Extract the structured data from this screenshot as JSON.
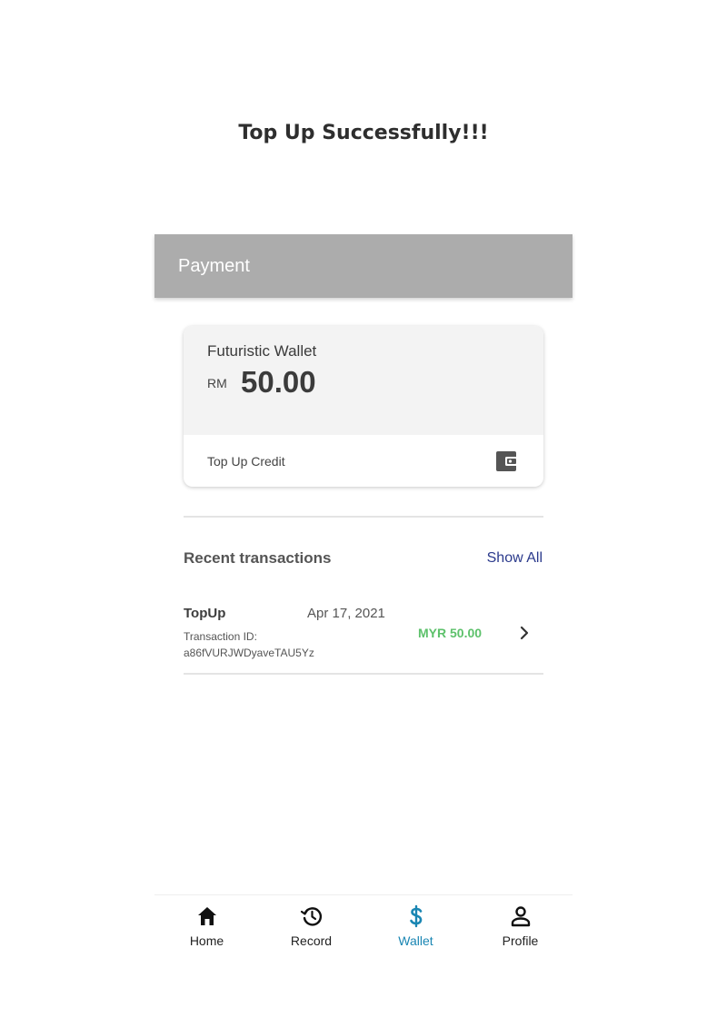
{
  "caption": "Top Up Successfully!!!",
  "app_bar": {
    "title": "Payment"
  },
  "wallet": {
    "name": "Futuristic Wallet",
    "currency": "RM",
    "balance": "50.00",
    "top_up_label": "Top Up Credit",
    "top_up_icon": "wallet-icon"
  },
  "transactions": {
    "title": "Recent transactions",
    "show_all": "Show All",
    "items": [
      {
        "type": "TopUp",
        "date": "Apr 17, 2021",
        "id_label": "Transaction ID:",
        "id": "a86fVURJWDyaveTAU5Yz",
        "amount": "MYR 50.00",
        "icon": "chevron-right-icon"
      }
    ]
  },
  "nav": {
    "items": [
      {
        "label": "Home",
        "icon": "home-icon"
      },
      {
        "label": "Record",
        "icon": "history-icon"
      },
      {
        "label": "Wallet",
        "icon": "dollar-icon"
      },
      {
        "label": "Profile",
        "icon": "person-icon"
      }
    ],
    "active": "Wallet"
  },
  "colors": {
    "app_bar": "#acacac",
    "amount_positive": "#5dc16b",
    "link": "#2b3a8c",
    "nav_active": "#1a86b3"
  }
}
